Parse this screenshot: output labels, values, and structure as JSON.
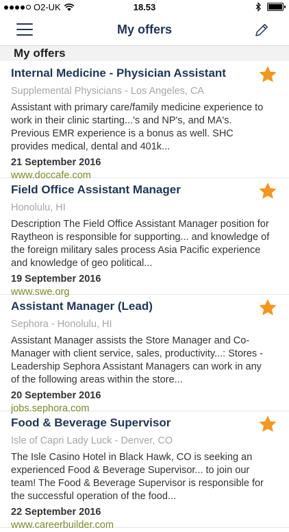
{
  "status_bar": {
    "carrier": "O2-UK",
    "time": "18.53",
    "battery_level": 0.9
  },
  "nav": {
    "title": "My offers"
  },
  "section": {
    "header": "My offers"
  },
  "colors": {
    "title": "#1f3556",
    "source": "#7b8a2a",
    "star": "#f5961e"
  },
  "offers": [
    {
      "title": "Internal Medicine - Physician Assistant",
      "company": "Supplemental Physicians - Los Angeles, CA",
      "description": "Assistant with primary care/family medicine experience to work in their clinic starting...'s and NP's, and MA's. Previous EMR experience is a bonus as well.   SHC provides medical, dental and 401k...",
      "date": "21 September 2016",
      "source": "www.doccafe.com",
      "starred": true
    },
    {
      "title": "Field Office Assistant Manager",
      "company": "Honolulu, HI",
      "description": "Description  The Field Office Assistant Manager position for Raytheon is responsible for supporting... and knowledge of the foreign military sales process    Asia Pacific experience and knowledge of geo political...",
      "date": "19 September 2016",
      "source": "www.swe.org",
      "starred": true
    },
    {
      "title": "Assistant Manager (Lead)",
      "company": "Sephora - Honolulu, HI",
      "description": "Assistant Manager assists the Store Manager and Co-Manager with client service, sales, productivity...: Stores - Leadership  Sephora Assistant Managers can work in any of the following areas within the store...",
      "date": "20 September 2016",
      "source": "jobs.sephora.com",
      "starred": true
    },
    {
      "title": "Food & Beverage Supervisor",
      "company": "Isle of Capri Lady Luck - Denver, CO",
      "description": "The Isle Casino Hotel in Black Hawk, CO is seeking an experienced Food & Beverage Supervisor... to join our team!   The Food & Beverage Supervisor is responsible for the successful operation of the food...",
      "date": "22 September 2016",
      "source": "www.careerbuilder.com",
      "starred": true
    }
  ]
}
